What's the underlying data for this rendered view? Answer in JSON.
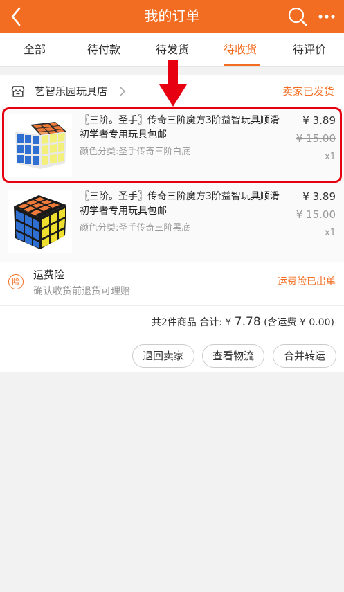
{
  "header": {
    "title": "我的订单"
  },
  "tabs": [
    {
      "label": "全部",
      "active": false
    },
    {
      "label": "待付款",
      "active": false
    },
    {
      "label": "待发货",
      "active": false
    },
    {
      "label": "待收货",
      "active": true
    },
    {
      "label": "待评价",
      "active": false
    }
  ],
  "shop": {
    "name": "艺智乐园玩具店",
    "status": "卖家已发货"
  },
  "items": [
    {
      "title": "〖三阶。圣手〗传奇三阶魔方3阶益智玩具顺滑 初学者专用玩具包邮",
      "sku": "颜色分类:圣手传奇三阶白底",
      "price": "¥ 3.89",
      "orig_price": "¥ 15.00",
      "qty": "x1",
      "highlighted": true
    },
    {
      "title": "〖三阶。圣手〗传奇三阶魔方3阶益智玩具顺滑 初学者专用玩具包邮",
      "sku": "颜色分类:圣手传奇三阶黑底",
      "price": "¥ 3.89",
      "orig_price": "¥ 15.00",
      "qty": "x1",
      "highlighted": false
    }
  ],
  "insurance": {
    "badge": "险",
    "title": "运费险",
    "desc": "确认收货前退货可理赔",
    "status": "运费险已出单"
  },
  "summary": {
    "prefix": "共2件商品 合计: ¥ ",
    "total": "7.78",
    "suffix": " (含运费 ¥ 0.00)"
  },
  "actions": {
    "return": "退回卖家",
    "logistics": "查看物流",
    "merge": "合并转运"
  },
  "colors": {
    "brand": "#f26d21",
    "highlight": "#e60012"
  }
}
